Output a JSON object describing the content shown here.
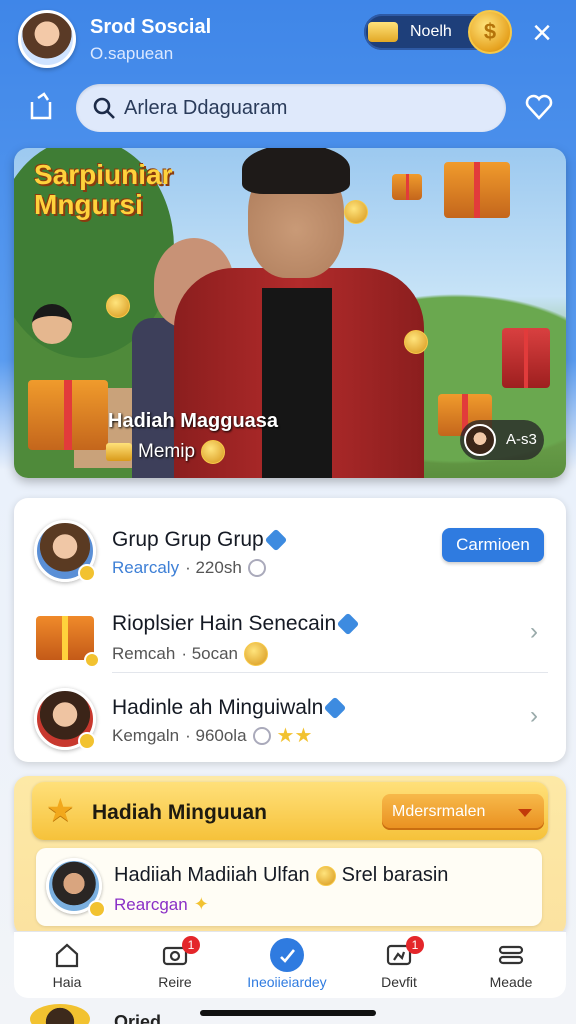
{
  "header": {
    "title": "Srod Soscial",
    "subtitle": "O.sapuean",
    "coin_pill_label": "Noelh",
    "coin_symbol": "$"
  },
  "search": {
    "value": "Arlera Ddaguaram",
    "placeholder": ""
  },
  "banner": {
    "title": "Sarpiuniar Mngursi",
    "caption": "Hadiah Magguasa",
    "sub_label": "Memip",
    "badge_label": "A-s3"
  },
  "list": {
    "items": [
      {
        "name": "Grup Grup Grup",
        "highlight": "Rearcaly",
        "meta": "· 220sh",
        "action": "Carmioen"
      },
      {
        "name": "Rioplsier Hain Senecain",
        "highlight": "Remcah",
        "meta": "· 5ocan"
      },
      {
        "name": "Hadinle ah Minguiwaln",
        "highlight": "Kemgaln",
        "meta": "· 960ola"
      }
    ]
  },
  "weekly": {
    "title": "Hadiah Minguuan",
    "dropdown_value": "Mdersrmalen",
    "item": {
      "name_part1": "Hadiiah Madiiah Ulfan",
      "name_part2": "Srel barasin",
      "sub": "Rearcgan"
    }
  },
  "nav": {
    "items": [
      {
        "label": "Haia",
        "badge": ""
      },
      {
        "label": "Reire",
        "badge": "1"
      },
      {
        "label": "Ineoiieiardey",
        "badge": ""
      },
      {
        "label": "Devfit",
        "badge": "1"
      },
      {
        "label": "Meade",
        "badge": ""
      }
    ]
  },
  "peek": {
    "text": "Oried"
  },
  "colors": {
    "accent_blue": "#2f7be0",
    "header_blue": "#3f86e8",
    "gold": "#f2c230",
    "badge_red": "#e4262a",
    "reward_yellow": "#fde9a6"
  },
  "icons": [
    "search-icon",
    "share-icon",
    "heart-icon",
    "close-icon",
    "home-icon",
    "camera-icon",
    "compass-icon",
    "run-icon",
    "menu-icon",
    "star-icon",
    "chevron-right-icon",
    "chevron-down-icon",
    "verified-diamond-icon",
    "coin-icon",
    "gold-bar-icon"
  ]
}
